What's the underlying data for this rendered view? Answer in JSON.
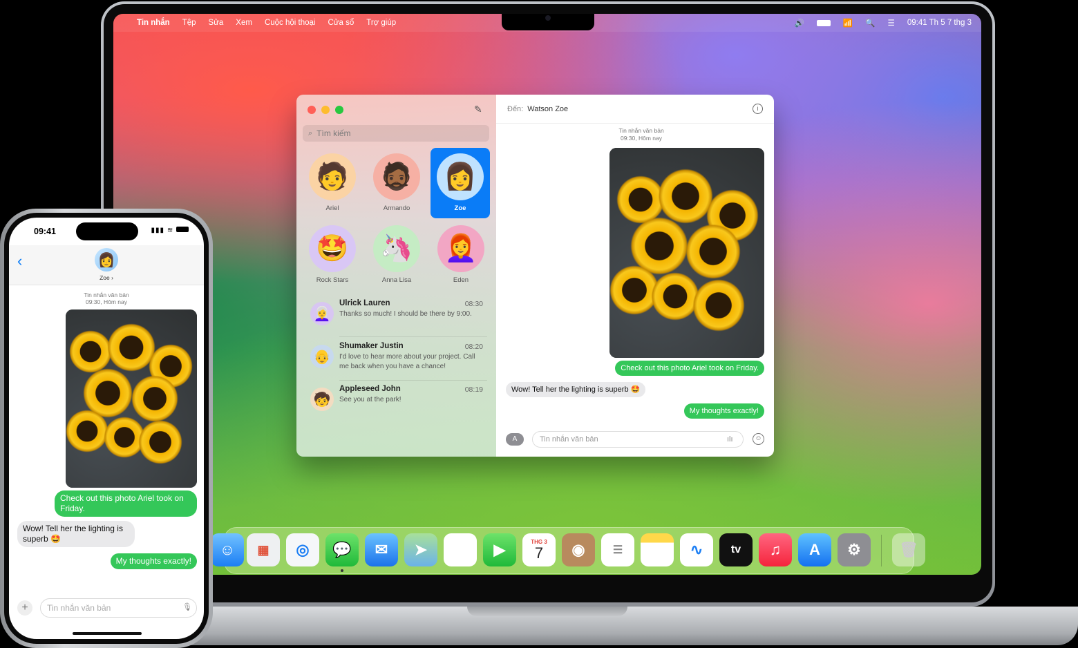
{
  "mac": {
    "menubar": {
      "apple_icon": "apple-icon",
      "items": [
        "Tin nhắn",
        "Tệp",
        "Sửa",
        "Xem",
        "Cuộc hội thoại",
        "Cửa sổ",
        "Trợ giúp"
      ],
      "clock": "09:41 Th 5 7 thg 3"
    },
    "messages": {
      "search_placeholder": "Tìm kiếm",
      "pinned": [
        {
          "name": "Ariel",
          "emoji": "🧑"
        },
        {
          "name": "Armando",
          "emoji": "🧔🏾"
        },
        {
          "name": "Zoe",
          "emoji": "👩"
        },
        {
          "name": "Rock Stars",
          "emoji": "🤩"
        },
        {
          "name": "Anna Lisa",
          "emoji": "🦄"
        },
        {
          "name": "Eden",
          "emoji": "👩‍🦰"
        }
      ],
      "conversations": [
        {
          "name": "Ulrick Lauren",
          "time": "08:30",
          "preview": "Thanks so much! I should be there by 9:00.",
          "emoji": "👩‍🦳"
        },
        {
          "name": "Shumaker Justin",
          "time": "08:20",
          "preview": "I'd love to hear more about your project. Call me back when you have a chance!",
          "emoji": "👴"
        },
        {
          "name": "Appleseed John",
          "time": "08:19",
          "preview": "See you at the park!",
          "emoji": "🧒"
        }
      ],
      "chat": {
        "to_label": "Đến:",
        "to_name": "Watson Zoe",
        "stamp_line1": "Tin nhắn văn bản",
        "stamp_line2": "09:30, Hôm nay",
        "msg1": "Check out this photo Ariel took on Friday.",
        "msg2": "Wow! Tell her the lighting is superb 🤩",
        "msg3": "My thoughts exactly!",
        "input_placeholder": "Tin nhắn văn bản"
      }
    },
    "dock": {
      "calendar_month": "THG 3",
      "calendar_day": "7",
      "apps": [
        "finder",
        "launchpad",
        "safari",
        "messages",
        "mail",
        "maps",
        "photos",
        "facetime",
        "calendar",
        "contacts",
        "reminders",
        "notes",
        "freeform",
        "tv",
        "music",
        "app-store",
        "system-settings",
        "trash"
      ]
    }
  },
  "iphone": {
    "time": "09:41",
    "contact": "Zoe",
    "stamp_line1": "Tin nhắn văn bản",
    "stamp_line2": "09:30, Hôm nay",
    "msg1": "Check out this photo Ariel took on Friday.",
    "msg2": "Wow! Tell her the lighting is superb 🤩",
    "msg3": "My thoughts exactly!",
    "input_placeholder": "Tin nhắn văn bản"
  },
  "colors": {
    "imessage_green": "#34c759",
    "accent_blue": "#0a7cf7"
  }
}
